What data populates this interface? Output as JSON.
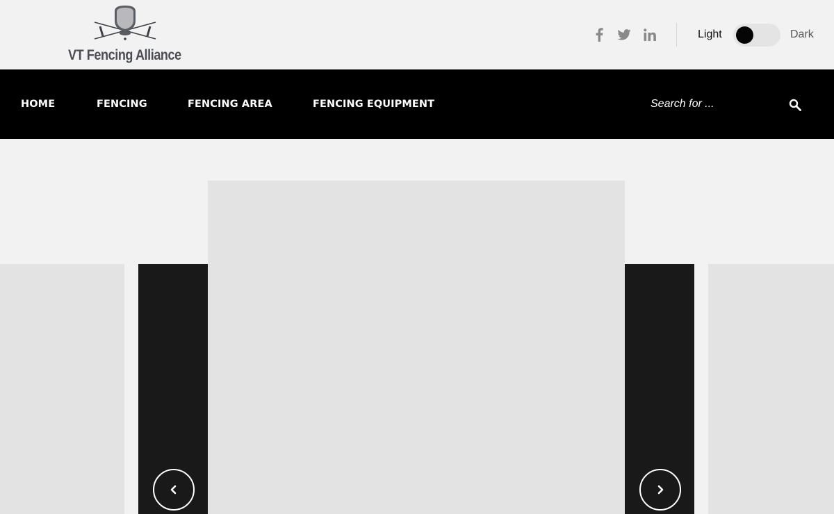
{
  "header": {
    "logo_text": "VT Fencing Alliance",
    "social": [
      {
        "name": "facebook-icon"
      },
      {
        "name": "twitter-icon"
      },
      {
        "name": "linkedin-icon"
      }
    ],
    "theme_toggle": {
      "light_label": "Light",
      "dark_label": "Dark",
      "selected": "Light"
    }
  },
  "nav": {
    "items": [
      {
        "label": "HOME"
      },
      {
        "label": "FENCING"
      },
      {
        "label": "FENCING AREA"
      },
      {
        "label": "FENCING EQUIPMENT"
      }
    ],
    "search": {
      "placeholder": "Search for ...",
      "value": ""
    }
  },
  "carousel": {
    "prev_icon": "chevron-left-icon",
    "next_icon": "chevron-right-icon"
  },
  "colors": {
    "page_background": "#f2f2f2",
    "nav_background": "#000000",
    "slide_placeholder": "#e3e3e3",
    "slide_dark": "#191919",
    "logo_text": "#4a4d55",
    "social_icon": "#8a8a8a"
  }
}
